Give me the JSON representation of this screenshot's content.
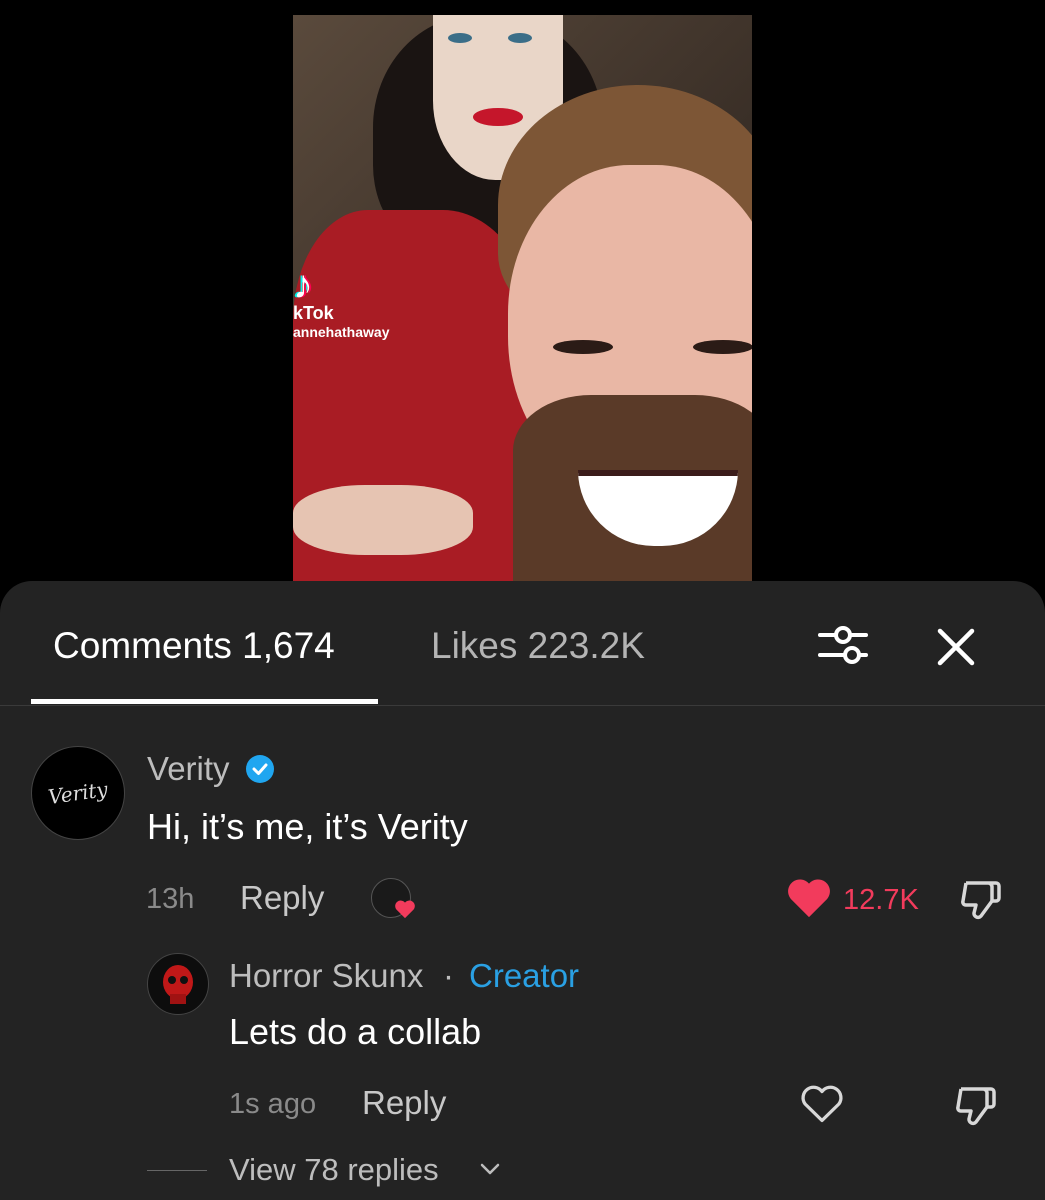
{
  "video": {
    "watermark_brand": "kTok",
    "watermark_handle": "annehathaway"
  },
  "comments_panel": {
    "tabs": [
      {
        "label": "Comments 1,674",
        "active": true
      },
      {
        "label": "Likes 223.2K",
        "active": false
      }
    ],
    "icons": {
      "filter": "filter-sliders-icon",
      "close": "close-icon"
    }
  },
  "comment": {
    "author": "Verity",
    "avatar_text": "Verity",
    "verified": true,
    "text": "Hi, it’s me, it’s Verity",
    "time": "13h",
    "reply_label": "Reply",
    "likes": "12.7K",
    "liked": true,
    "like_color": "#f23b5c"
  },
  "reply": {
    "author": "Horror Skunx",
    "separator": "·",
    "badge": "Creator",
    "badge_color": "#2aa0e3",
    "text": "Lets do a collab",
    "time": "1s ago",
    "reply_label": "Reply",
    "liked": false
  },
  "view_replies": "View 78 replies"
}
